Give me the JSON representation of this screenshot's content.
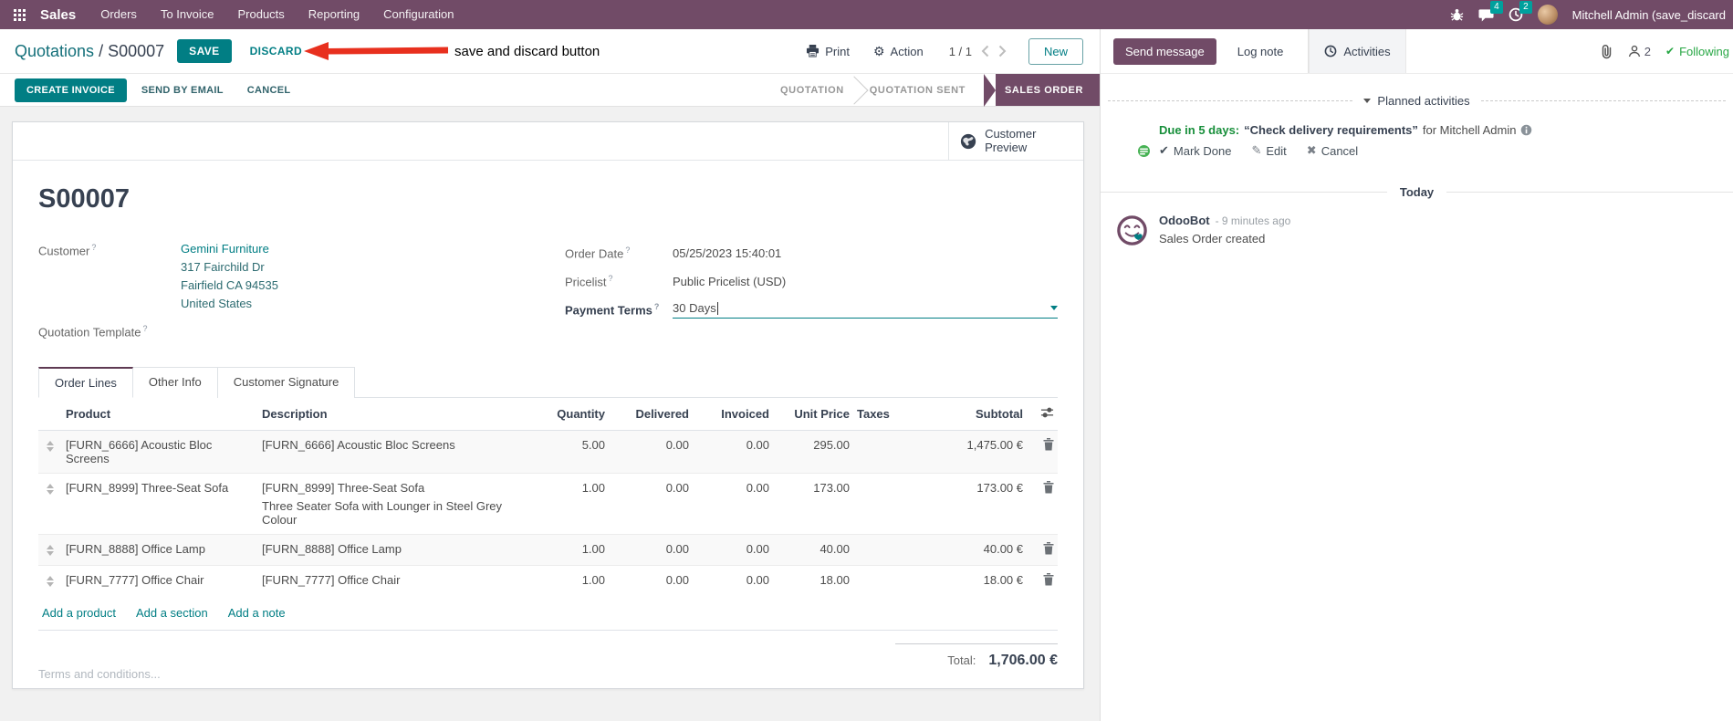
{
  "colors": {
    "brand_purple": "#714B67",
    "accent_teal": "#017E84",
    "badge_teal": "#00A09D",
    "success_green": "#28a745",
    "modified_blue": "#0e7bb6",
    "annotation_red": "#e8301e"
  },
  "nav": {
    "app_name": "Sales",
    "menus": [
      "Orders",
      "To Invoice",
      "Products",
      "Reporting",
      "Configuration"
    ],
    "messages_badge": "4",
    "activities_badge": "2",
    "user_name": "Mitchell Admin (save_discard"
  },
  "control": {
    "breadcrumb_parent": "Quotations",
    "breadcrumb_divider": "/",
    "breadcrumb_current": "S00007",
    "save_label": "SAVE",
    "discard_label": "DISCARD",
    "print_label": "Print",
    "action_label": "Action",
    "pager": "1 / 1",
    "new_label": "New"
  },
  "annotation": {
    "text": "save and discard button"
  },
  "statusbar": {
    "create_invoice": "CREATE INVOICE",
    "send_by_email": "SEND BY EMAIL",
    "cancel": "CANCEL",
    "stages": [
      "QUOTATION",
      "QUOTATION SENT"
    ],
    "active_stage": "SALES ORDER"
  },
  "sheet": {
    "customer_preview": "Customer Preview",
    "title": "S00007",
    "help_mark": "?",
    "customer_label": "Customer",
    "customer_name": "Gemini Furniture",
    "address_line1": "317 Fairchild Dr",
    "address_line2": "Fairfield CA 94535",
    "address_line3": "United States",
    "quotation_template_label": "Quotation Template",
    "order_date_label": "Order Date",
    "order_date_value": "05/25/2023 15:40:01",
    "pricelist_label": "Pricelist",
    "pricelist_value": "Public Pricelist (USD)",
    "payment_terms_label": "Payment Terms",
    "payment_terms_value": "30 Days"
  },
  "tabs": [
    "Order Lines",
    "Other Info",
    "Customer Signature"
  ],
  "table": {
    "headers": {
      "product": "Product",
      "description": "Description",
      "quantity": "Quantity",
      "delivered": "Delivered",
      "invoiced": "Invoiced",
      "unit_price": "Unit Price",
      "taxes": "Taxes",
      "subtotal": "Subtotal"
    },
    "rows": [
      {
        "product": "[FURN_6666] Acoustic Bloc Screens",
        "description": "[FURN_6666] Acoustic Bloc Screens",
        "quantity": "5.00",
        "delivered": "0.00",
        "invoiced": "0.00",
        "unit_price": "295.00",
        "subtotal": "1,475.00 €"
      },
      {
        "product": "[FURN_8999] Three-Seat Sofa",
        "description": "[FURN_8999] Three-Seat Sofa",
        "description2": "Three Seater Sofa with Lounger in Steel Grey Colour",
        "quantity": "1.00",
        "delivered": "0.00",
        "invoiced": "0.00",
        "unit_price": "173.00",
        "subtotal": "173.00 €"
      },
      {
        "product": "[FURN_8888] Office Lamp",
        "description": "[FURN_8888] Office Lamp",
        "quantity": "1.00",
        "delivered": "0.00",
        "invoiced": "0.00",
        "unit_price": "40.00",
        "subtotal": "40.00 €"
      },
      {
        "product": "[FURN_7777] Office Chair",
        "description": "[FURN_7777] Office Chair",
        "quantity": "1.00",
        "delivered": "0.00",
        "invoiced": "0.00",
        "unit_price": "18.00",
        "subtotal": "18.00 €"
      }
    ],
    "links": [
      "Add a product",
      "Add a section",
      "Add a note"
    ],
    "terms_placeholder": "Terms and conditions...",
    "total_label": "Total:",
    "total_value": "1,706.00 €"
  },
  "chatter": {
    "send_message": "Send message",
    "log_note": "Log note",
    "activities_tab": "Activities",
    "followers_count": "2",
    "following": "Following",
    "planned_header": "Planned activities",
    "activity": {
      "due": "Due in 5 days:",
      "title": "“Check delivery requirements”",
      "assignee": "for Mitchell Admin",
      "mark_done": "Mark Done",
      "edit": "Edit",
      "cancel": "Cancel"
    },
    "today_divider": "Today",
    "message": {
      "author": "OdooBot",
      "timestamp": "- 9 minutes ago",
      "body": "Sales Order created"
    }
  }
}
